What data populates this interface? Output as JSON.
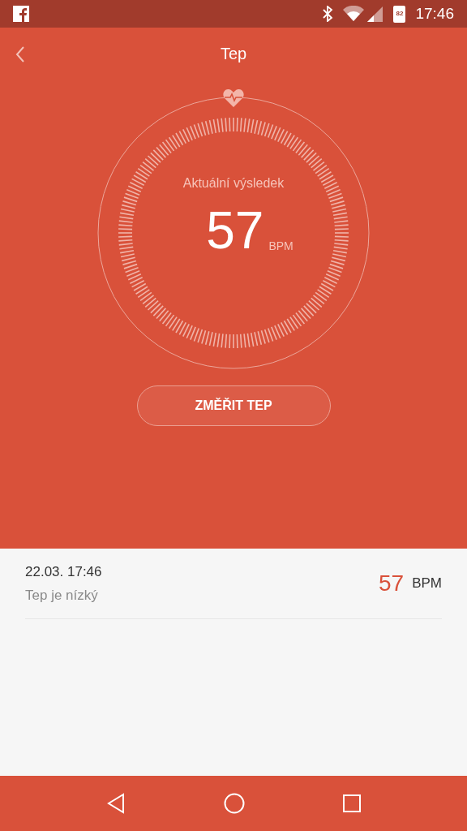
{
  "status_bar": {
    "battery": "82",
    "time": "17:46"
  },
  "header": {
    "title": "Tep"
  },
  "dial": {
    "caption": "Aktuální výsledek",
    "value": "57",
    "unit": "BPM"
  },
  "measure_button": {
    "label": "ZMĚŘIT TEP"
  },
  "history": [
    {
      "date": "22.03. 17:46",
      "note": "Tep je nízký",
      "value": "57",
      "unit": "BPM"
    }
  ]
}
